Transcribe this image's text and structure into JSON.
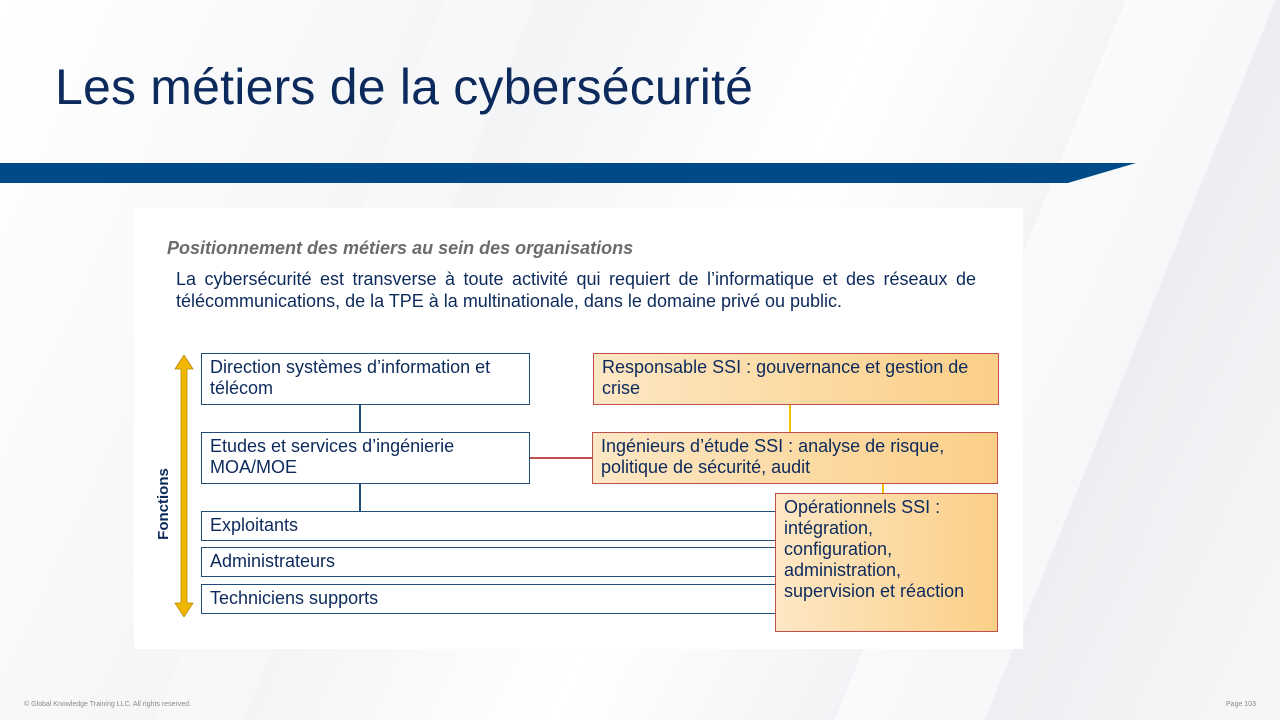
{
  "slide": {
    "title": "Les métiers de la cybersécurité",
    "footer_left": "© Global Knowledge Training LLC. All rights reserved.",
    "footer_right": "Page 103",
    "colors": {
      "title": "#0d2a5c",
      "band": "#004b87",
      "box_border": "#1f4e79",
      "orange_border": "#c0504d",
      "arrow": "#f2b705"
    }
  },
  "figure": {
    "heading": "Positionnement des métiers au sein des organisations",
    "intro": "La cybersécurité est transverse à toute activité qui requiert de l’informatique et des réseaux de télécommunications, de la TPE à la multinationale, dans le domaine privé ou public.",
    "axis_label": "Fonctions",
    "functions": [
      "Direction systèmes d’information et télécom",
      "Etudes et services d’ingénierie MOA/MOE",
      "Exploitants",
      "Administrateurs",
      "Techniciens supports"
    ],
    "ssi_roles": [
      "Responsable SSI : gouvernance et gestion de crise",
      "Ingénieurs d’étude SSI : analyse de risque, politique de sécurité, audit",
      "Opérationnels SSI : intégration, configuration, administration, supervision et réaction"
    ]
  }
}
